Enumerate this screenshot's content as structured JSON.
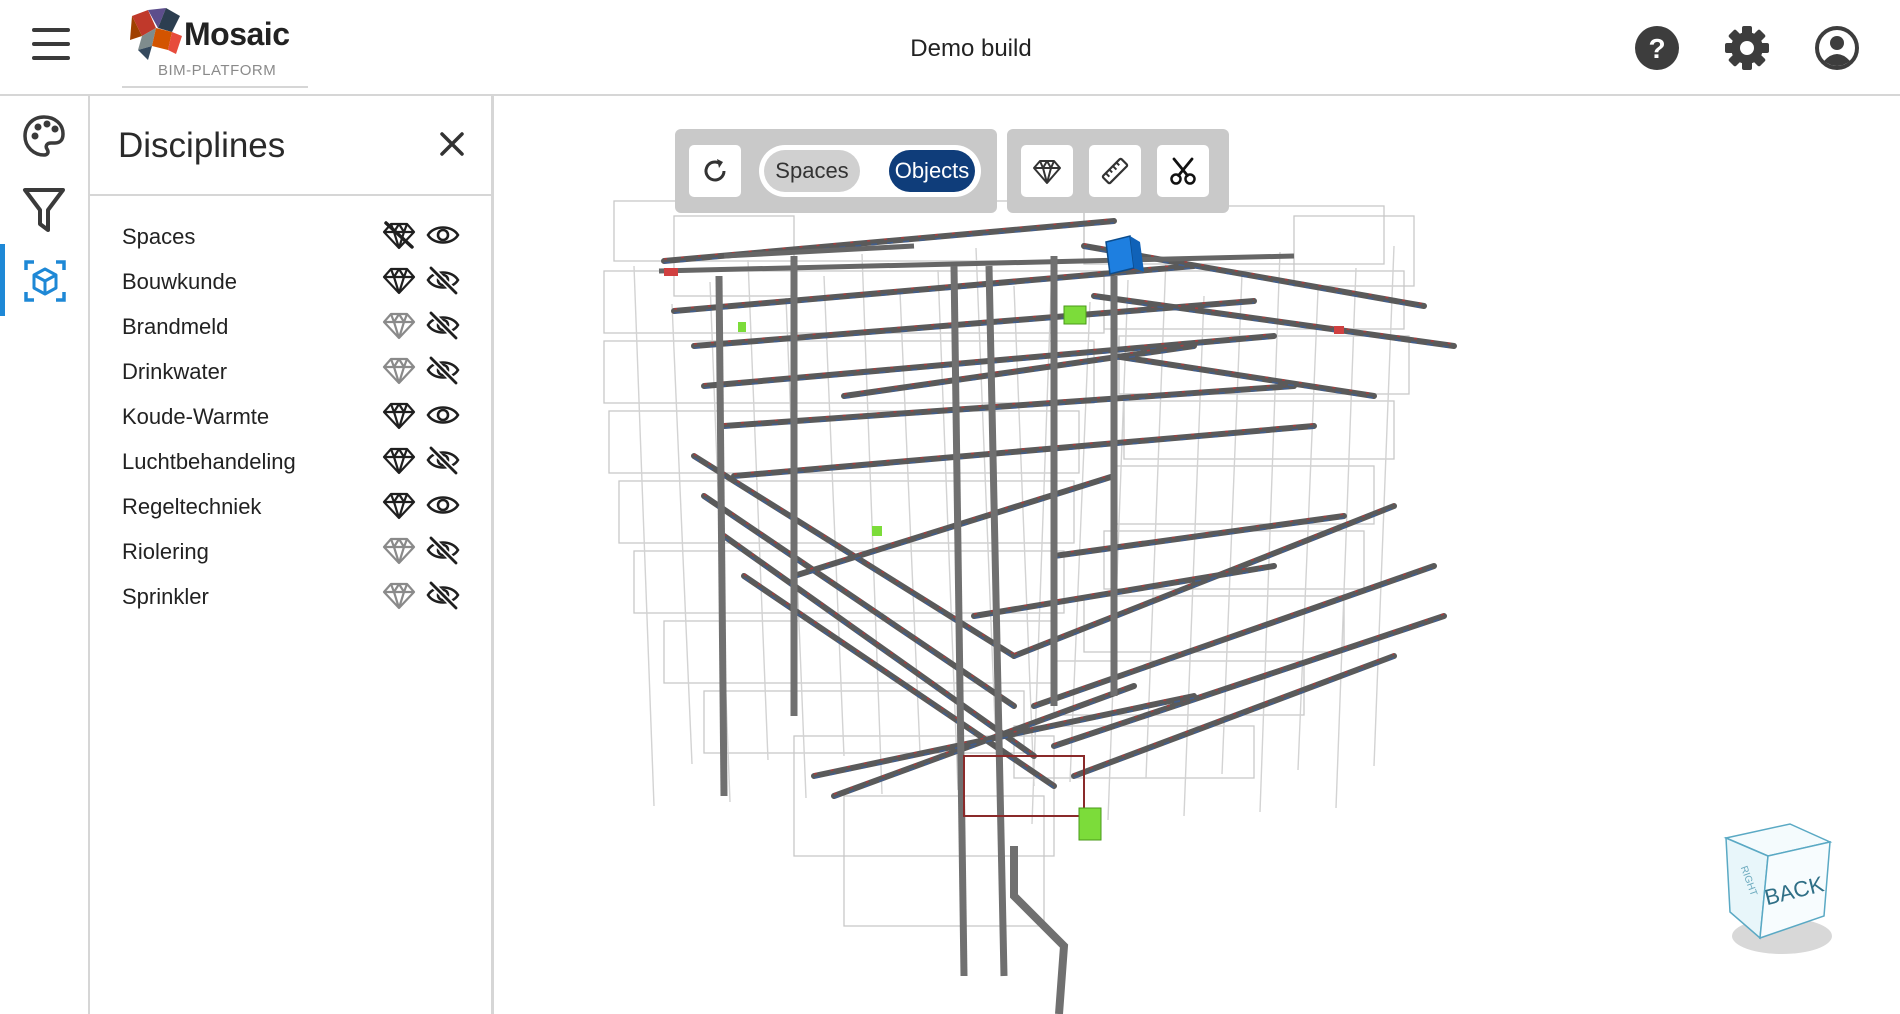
{
  "app": {
    "logo_word": "Mosaic",
    "logo_sub": "BIM-PLATFORM",
    "title": "Demo build"
  },
  "header_icons": [
    "help-icon",
    "settings-gear-icon",
    "user-account-icon"
  ],
  "rail": {
    "items": [
      "palette-icon",
      "filter-icon",
      "cube-box-icon"
    ],
    "active": "cube-box-icon",
    "accent": "#1e88d6"
  },
  "panel": {
    "title": "Disciplines",
    "disciplines": [
      {
        "name": "Spaces",
        "ghost": "off",
        "visible": true
      },
      {
        "name": "Bouwkunde",
        "ghost": "active",
        "visible": false
      },
      {
        "name": "Brandmeld",
        "ghost": "inactive",
        "visible": false
      },
      {
        "name": "Drinkwater",
        "ghost": "inactive",
        "visible": false
      },
      {
        "name": "Koude-Warmte",
        "ghost": "active",
        "visible": true
      },
      {
        "name": "Luchtbehandeling",
        "ghost": "active",
        "visible": false
      },
      {
        "name": "Regeltechniek",
        "ghost": "active",
        "visible": true
      },
      {
        "name": "Riolering",
        "ghost": "inactive",
        "visible": false
      },
      {
        "name": "Sprinkler",
        "ghost": "inactive",
        "visible": false
      }
    ]
  },
  "toolbar": {
    "toggle_spaces": "Spaces",
    "toggle_objects": "Objects",
    "selected": "Objects",
    "selected_color": "#0f3d7a",
    "tools": [
      "refresh-icon",
      "ghost-diamond-icon",
      "measure-ruler-icon",
      "section-scissors-icon"
    ]
  },
  "navcube": {
    "face_label": "BACK",
    "side_label": "RIGHT"
  }
}
